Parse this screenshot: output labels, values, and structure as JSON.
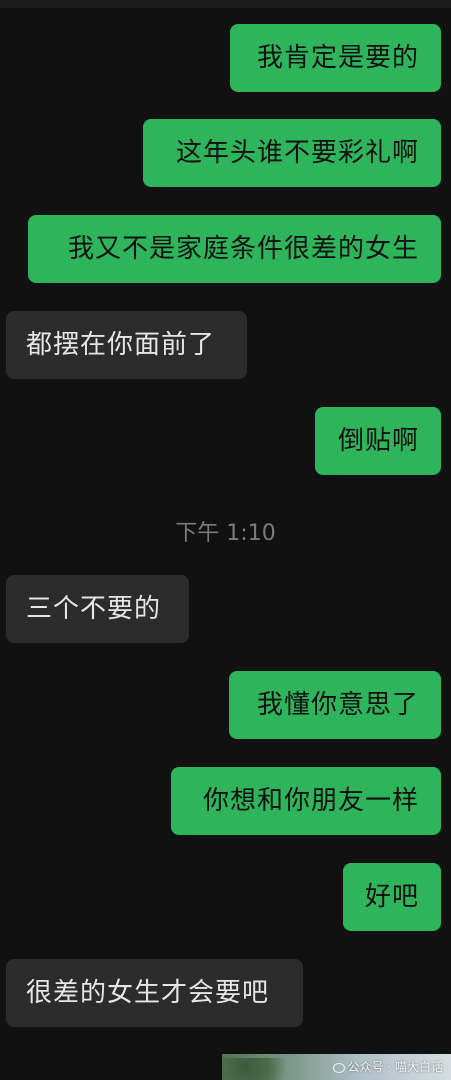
{
  "messages": [
    {
      "side": "out",
      "text": "我肯定是要的"
    },
    {
      "side": "out",
      "text": "这年头谁不要彩礼啊"
    },
    {
      "side": "out",
      "text": "我又不是家庭条件很差的女生"
    },
    {
      "side": "in",
      "text": "都摆在你面前了"
    },
    {
      "side": "out",
      "text": "倒贴啊"
    },
    {
      "side": "in",
      "text": "三个不要的"
    },
    {
      "side": "out",
      "text": "我懂你意思了"
    },
    {
      "side": "out",
      "text": "你想和你朋友一样"
    },
    {
      "side": "out",
      "text": "好吧"
    },
    {
      "side": "in",
      "text": "很差的女生才会要吧"
    }
  ],
  "timestamp": "下午 1:10",
  "watermark": "公众号 · 喵大白话",
  "colors": {
    "background": "#111111",
    "outgoing_bubble": "#2eb55b",
    "incoming_bubble": "#2c2c2c",
    "outgoing_text": "#111111",
    "incoming_text": "#e6e6e6",
    "timestamp_text": "#7b7b7b"
  }
}
